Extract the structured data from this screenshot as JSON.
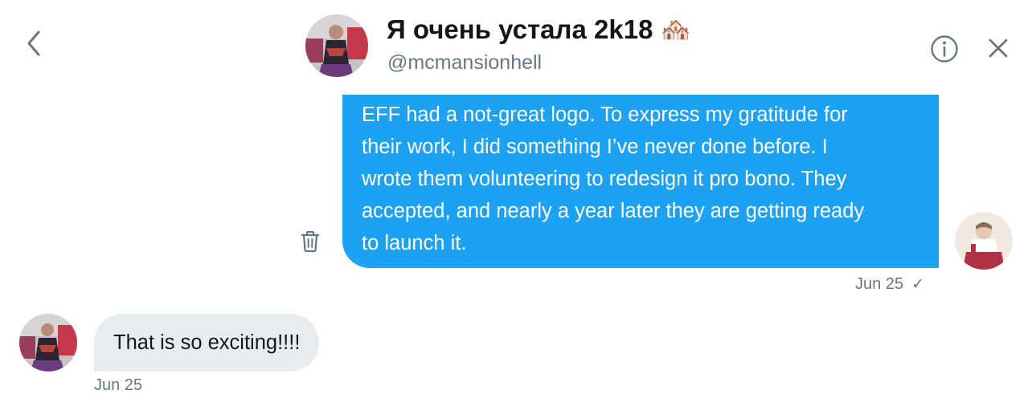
{
  "conversation": {
    "name": "Я очень устала 2k18",
    "name_emoji": "🏘️",
    "handle": "@mcmansionhell"
  },
  "messages": [
    {
      "direction": "sent",
      "text": "EFF had a not-great logo. To express my gratitude for their work, I did something I’ve never done before. I wrote them volunteering to redesign it pro bono. They accepted, and nearly a year later they are getting ready to launch it.",
      "lines": [
        "EFF had a not-great logo. To express my gratitude for",
        "their work, I did something I’ve never done before. I",
        "wrote them volunteering to redesign it pro bono. They",
        "accepted, and nearly a year later they are getting ready",
        "to launch it."
      ],
      "date": "Jun 25",
      "status_mark": "✓"
    },
    {
      "direction": "received",
      "text": "That is so exciting!!!!",
      "date": "Jun 25"
    }
  ],
  "icons": {
    "back": "chevron-left-icon",
    "info": "info-circle-icon",
    "close": "close-x-icon",
    "delete": "trash-icon"
  },
  "colors": {
    "accent": "#1da1f2",
    "received_bubble": "#e6ecf0",
    "secondary_text": "#657786",
    "icon_gray": "#657786",
    "primary_text": "#14171a"
  }
}
